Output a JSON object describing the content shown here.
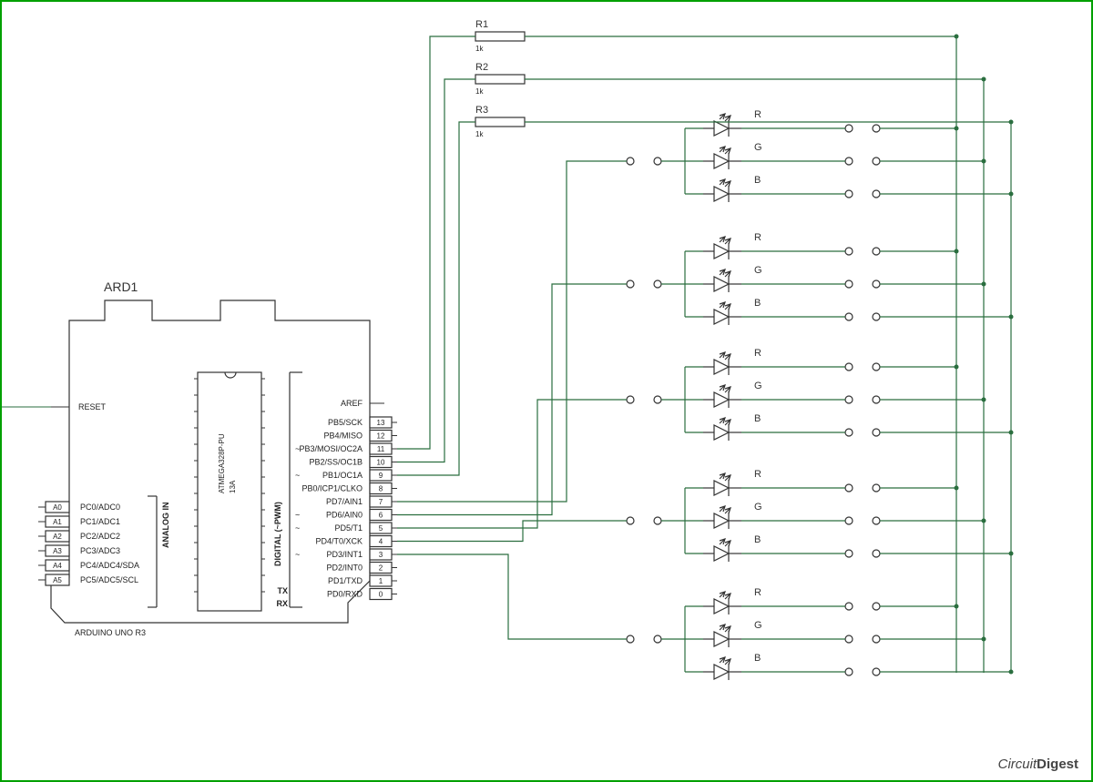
{
  "arduino": {
    "ref": "ARD1",
    "model": "ARDUINO UNO R3",
    "chip1": "ATMEGA328P-PU",
    "chip2": "13A",
    "sectionAnalog": "ANALOG IN",
    "sectionDigital": "DIGITAL (~PWM)",
    "tx": "TX",
    "rx": "RX",
    "aref": "AREF",
    "reset": "RESET",
    "analogPins": [
      "A0",
      "A1",
      "A2",
      "A3",
      "A4",
      "A5"
    ],
    "analogInner": [
      "PC0/ADC0",
      "PC1/ADC1",
      "PC2/ADC2",
      "PC3/ADC3",
      "PC4/ADC4/SDA",
      "PC5/ADC5/SCL"
    ],
    "digital": [
      {
        "n": "13",
        "name": "PB5/SCK",
        "tilde": ""
      },
      {
        "n": "12",
        "name": "PB4/MISO",
        "tilde": ""
      },
      {
        "n": "11",
        "name": "PB3/MOSI/OC2A",
        "tilde": "~"
      },
      {
        "n": "10",
        "name": "PB2/SS/OC1B",
        "tilde": ""
      },
      {
        "n": "9",
        "name": "PB1/OC1A",
        "tilde": "~"
      },
      {
        "n": "8",
        "name": "PB0/ICP1/CLKO",
        "tilde": ""
      },
      {
        "n": "7",
        "name": "PD7/AIN1",
        "tilde": ""
      },
      {
        "n": "6",
        "name": "PD6/AIN0",
        "tilde": "~"
      },
      {
        "n": "5",
        "name": "PD5/T1",
        "tilde": "~"
      },
      {
        "n": "4",
        "name": "PD4/T0/XCK",
        "tilde": ""
      },
      {
        "n": "3",
        "name": "PD3/INT1",
        "tilde": "~"
      },
      {
        "n": "2",
        "name": "PD2/INT0",
        "tilde": ""
      },
      {
        "n": "1",
        "name": "PD1/TXD",
        "tilde": ""
      },
      {
        "n": "0",
        "name": "PD0/RXD",
        "tilde": ""
      }
    ]
  },
  "resistors": [
    {
      "ref": "R1",
      "val": "1k"
    },
    {
      "ref": "R2",
      "val": "1k"
    },
    {
      "ref": "R3",
      "val": "1k"
    }
  ],
  "leds": {
    "groups": 5,
    "channels": [
      "R",
      "G",
      "B"
    ]
  },
  "brand": "CircuitDigest"
}
